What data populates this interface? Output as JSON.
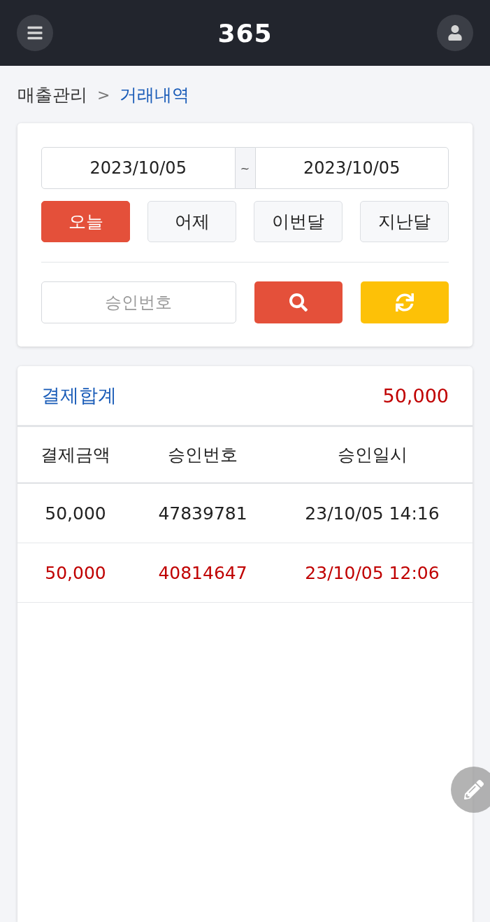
{
  "header": {
    "logo": "365"
  },
  "breadcrumb": {
    "parent": "매출관리",
    "separator": ">",
    "current": "거래내역"
  },
  "filter": {
    "date_from": "2023/10/05",
    "range_separator": "~",
    "date_to": "2023/10/05",
    "periods": [
      {
        "label": "오늘",
        "selected": true
      },
      {
        "label": "어제",
        "selected": false
      },
      {
        "label": "이번달",
        "selected": false
      },
      {
        "label": "지난달",
        "selected": false
      }
    ],
    "approval_search": {
      "placeholder": "승인번호"
    }
  },
  "summary": {
    "label": "결제합계",
    "total": "50,000"
  },
  "table": {
    "columns": [
      "결제금액",
      "승인번호",
      "승인일시"
    ],
    "rows": [
      {
        "cells": [
          "50,000",
          "47839781",
          "23/10/05 14:16"
        ],
        "color": "#222222"
      },
      {
        "cells": [
          "50,000",
          "40814647",
          "23/10/05 12:06"
        ],
        "color": "#c00000"
      }
    ]
  }
}
